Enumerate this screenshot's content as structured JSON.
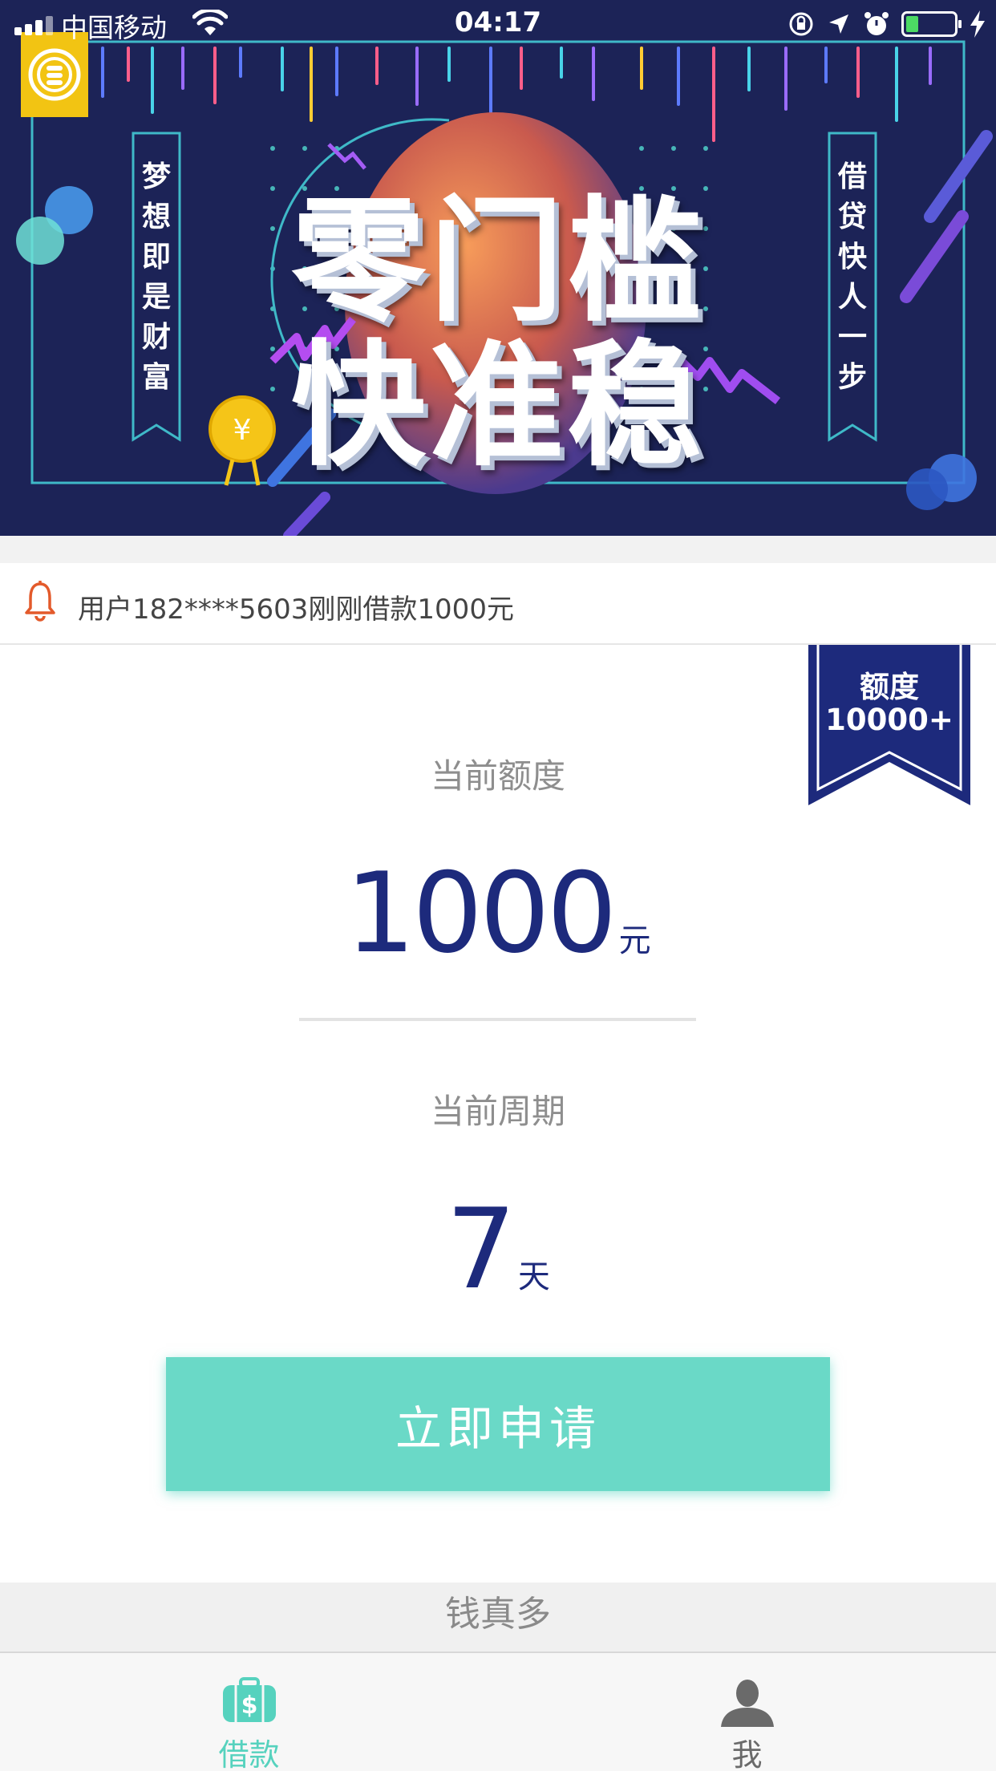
{
  "status_bar": {
    "carrier": "中国移动",
    "time": "04:17",
    "battery_level": 0.24
  },
  "banner": {
    "title_line1": "零门槛",
    "title_line2": "快准稳",
    "left_ribbon": [
      "梦",
      "想",
      "即",
      "是",
      "财",
      "富"
    ],
    "right_ribbon": [
      "借",
      "贷",
      "快",
      "人",
      "一",
      "步"
    ],
    "coin_symbol": "¥"
  },
  "notice": {
    "icon": "bell-icon",
    "text": "用户182****5603刚刚借款1000元"
  },
  "quota_badge": {
    "line1": "额度",
    "line2": "10000+"
  },
  "credit": {
    "label": "当前额度",
    "amount": "1000",
    "unit": "元"
  },
  "period": {
    "label": "当前周期",
    "days": "7",
    "unit": "天"
  },
  "apply_button": "立即申请",
  "footer_brand": "钱真多",
  "tabbar": {
    "items": [
      {
        "label": "借款",
        "icon": "money-bag-icon",
        "active": true
      },
      {
        "label": "我",
        "icon": "user-icon",
        "active": false
      }
    ]
  },
  "colors": {
    "primary_navy": "#1d2a7c",
    "accent_teal": "#6ad9c7",
    "banner_bg": "#1c2357",
    "bell": "#e35a2b"
  }
}
